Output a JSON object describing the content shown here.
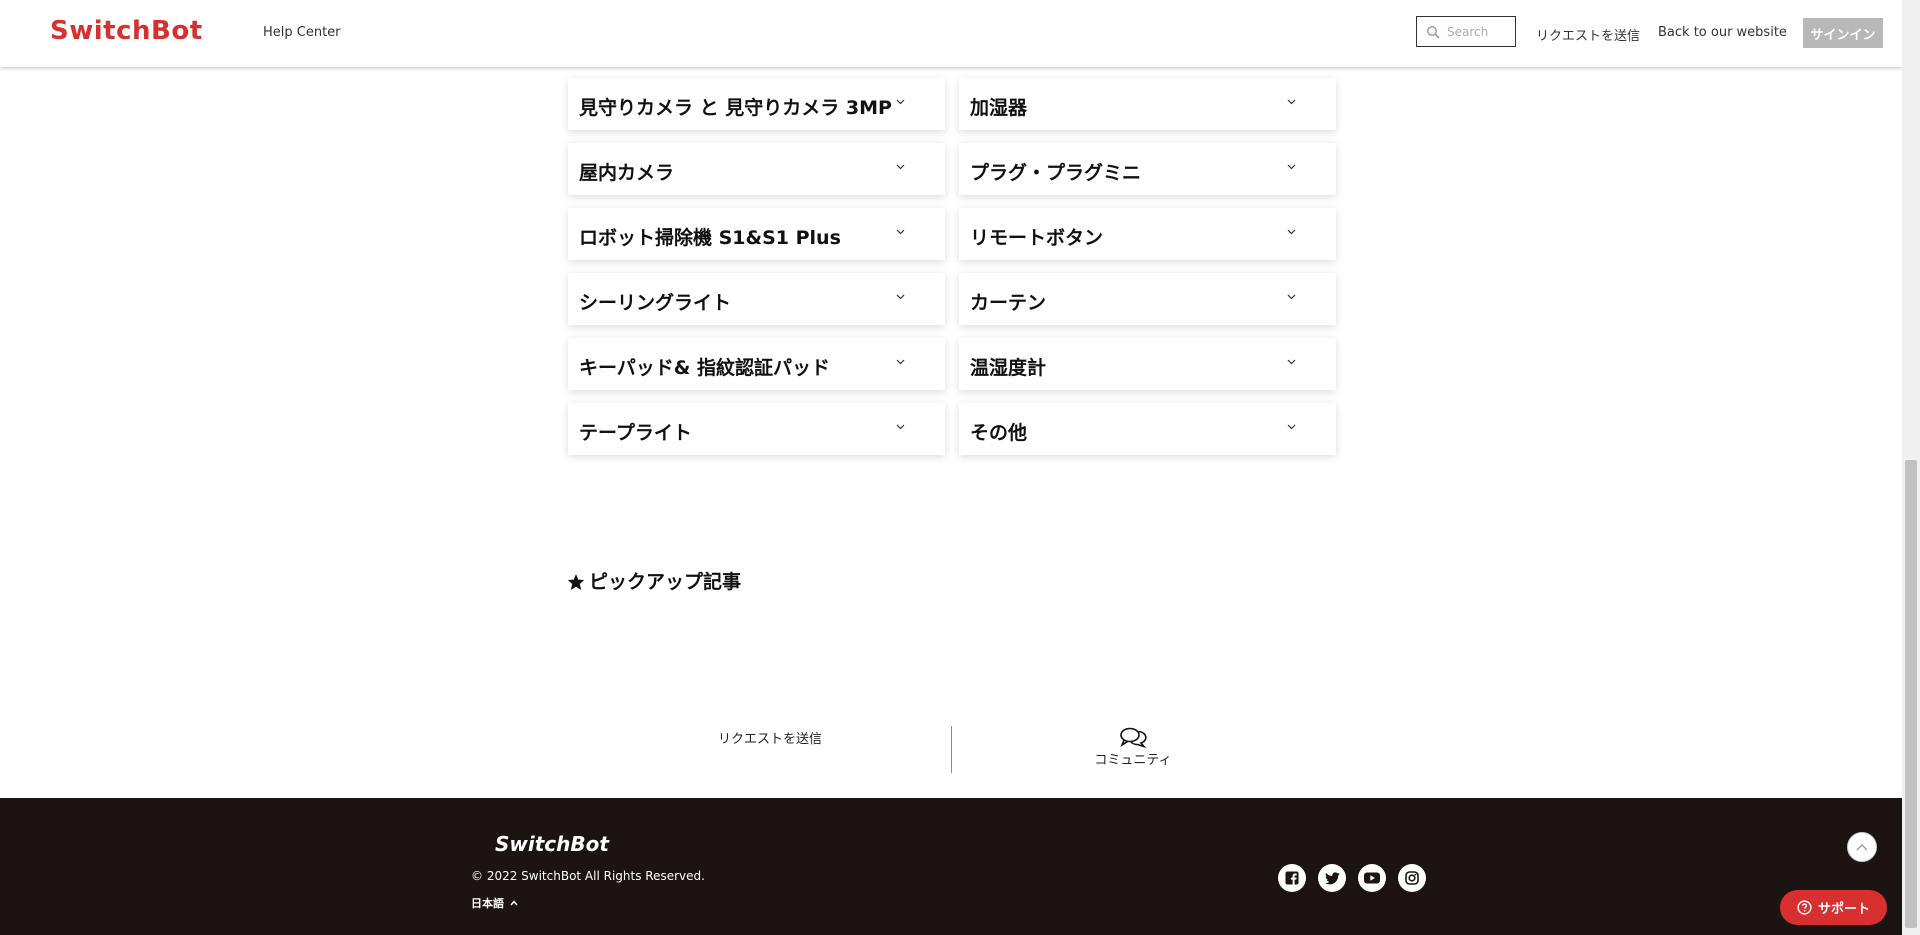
{
  "header": {
    "logo": "SwitchBot",
    "help_center": "Help Center",
    "search_placeholder": "Search",
    "request_label": "リクエストを送信",
    "back_label": "Back to our website",
    "signin_label": "サインイン"
  },
  "categories": [
    {
      "label": "見守りカメラ と 見守りカメラ 3MP"
    },
    {
      "label": "加湿器"
    },
    {
      "label": "屋内カメラ"
    },
    {
      "label": "プラグ・プラグミニ"
    },
    {
      "label": "ロボット掃除機 S1&S1 Plus"
    },
    {
      "label": "リモートボタン"
    },
    {
      "label": "シーリングライト"
    },
    {
      "label": "カーテン"
    },
    {
      "label": "キーパッド& 指紋認証パッド"
    },
    {
      "label": "温湿度計"
    },
    {
      "label": "テープライト"
    },
    {
      "label": "その他"
    }
  ],
  "pickup": {
    "title": "ピックアップ記事"
  },
  "bottom_links": {
    "request": "リクエストを送信",
    "community": "コミュニティ"
  },
  "footer": {
    "logo": "SwitchBot",
    "copyright": "© 2022 SwitchBot All Rights Reserved.",
    "language": "日本語",
    "social": [
      "facebook-icon",
      "twitter-icon",
      "youtube-icon",
      "instagram-icon"
    ]
  },
  "support": {
    "label": "サポート"
  },
  "colors": {
    "brand": "#d8302f",
    "footer_bg": "#1c1412",
    "signin_bg": "#b8b8b8",
    "divider": "#c77a3f"
  }
}
